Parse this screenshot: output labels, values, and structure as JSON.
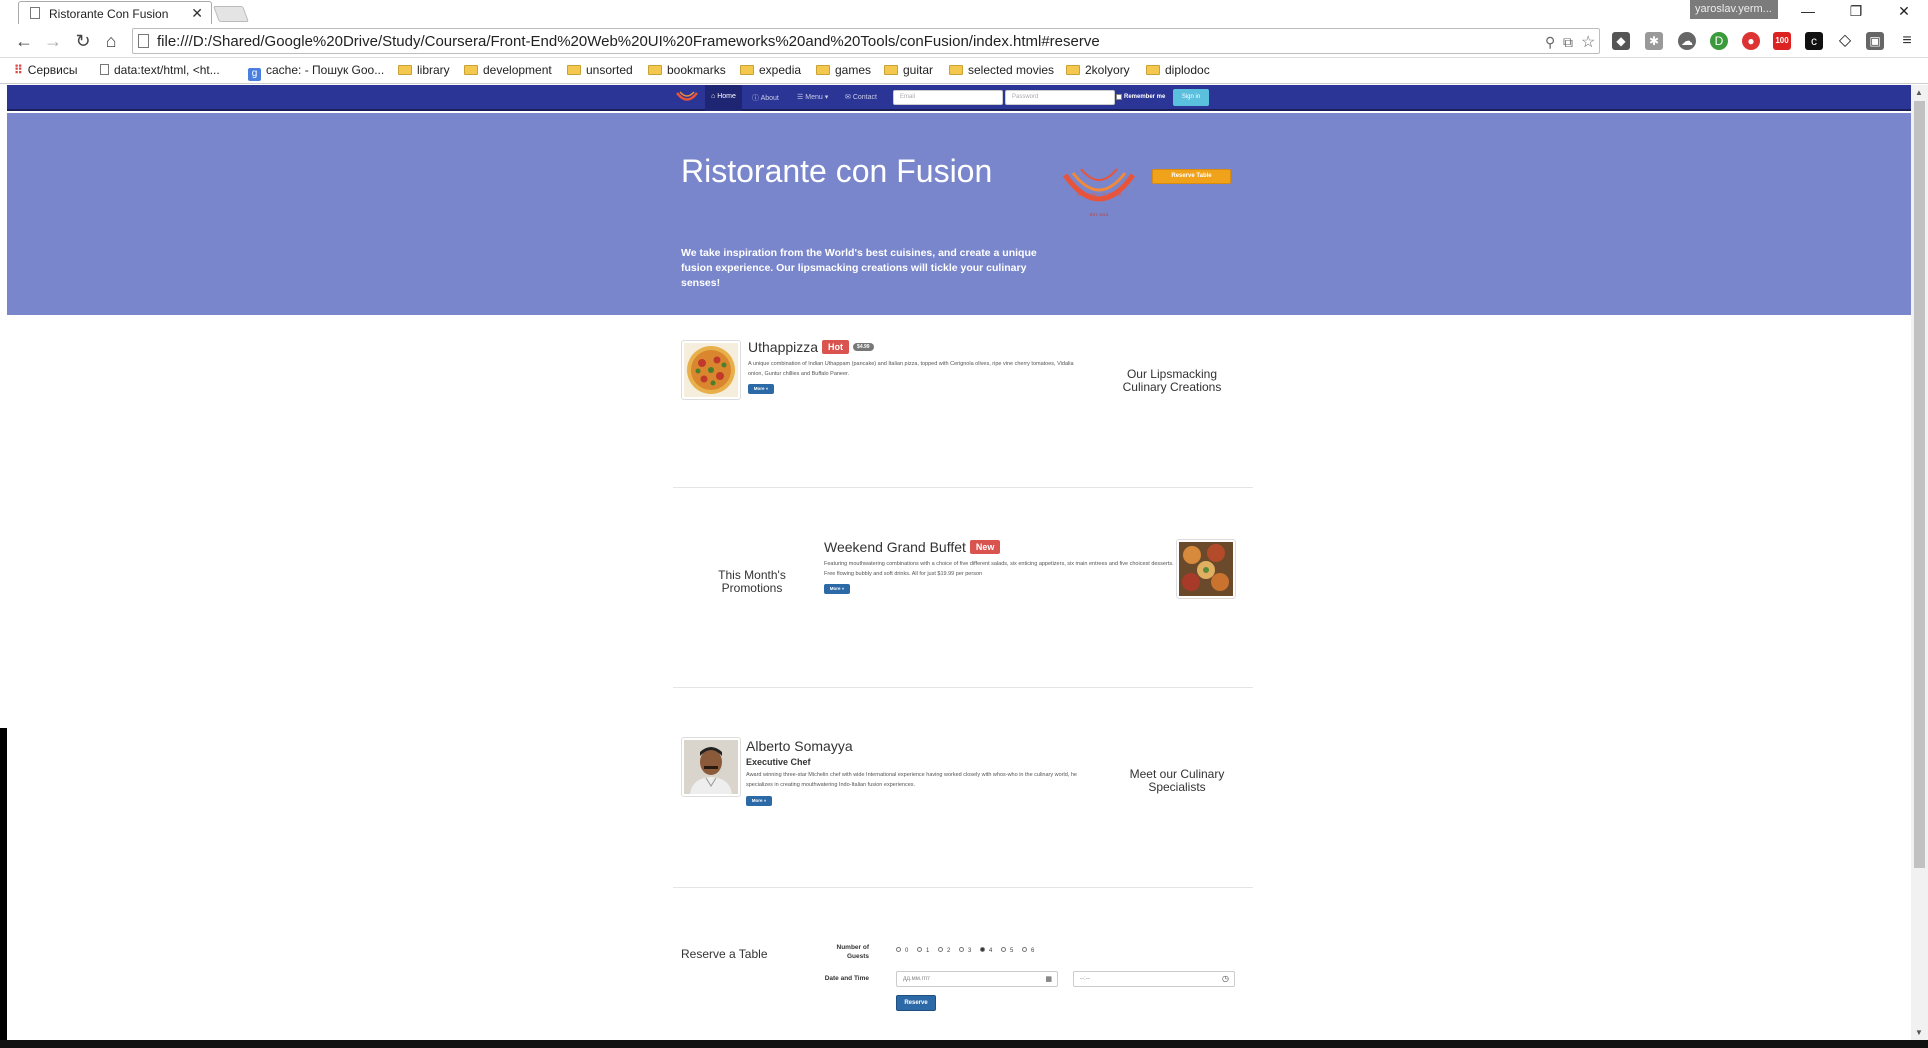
{
  "browser": {
    "tab_title": "Ristorante Con Fusion",
    "user": "yaroslav.yerm...",
    "url": "file:///D:/Shared/Google%20Drive/Study/Coursera/Front-End%20Web%20UI%20Frameworks%20and%20Tools/conFusion/index.html#reserve",
    "bookmarks": [
      "Сервисы",
      "data:text/html, <ht...",
      "cache: - Пошук Goo...",
      "library",
      "development",
      "unsorted",
      "bookmarks",
      "expedia",
      "games",
      "guitar",
      "selected movies",
      "2kolyory",
      "diplodoc"
    ],
    "ext_badge": "100"
  },
  "nav": {
    "items": [
      "Home",
      "About",
      "Menu",
      "Contact"
    ],
    "email_placeholder": "Email",
    "password_placeholder": "Password",
    "remember": "Remember me",
    "signin": "Sign in"
  },
  "jumbotron": {
    "title": "Ristorante con Fusion",
    "text": "We take inspiration from the World's best cuisines, and create a unique fusion experience. Our lipsmacking creations will tickle your culinary senses!",
    "reserve_button": "Reserve Table",
    "logo_text": "Ristorante con Fusion",
    "logo_est": "EST. 2013"
  },
  "dish": {
    "name": "Uthappizza",
    "badge": "Hot",
    "price": "$4.99",
    "description": "A unique combination of Indian Uthappam (pancake) and Italian pizza, topped with Cerignola olives, ripe vine cherry tomatoes, Vidalia onion, Guntur chillies and Buffalo Paneer.",
    "more": "More »",
    "side_heading": "Our Lipsmacking Culinary Creations"
  },
  "promotion": {
    "name": "Weekend Grand Buffet",
    "badge": "New",
    "description": "Featuring mouthwatering combinations with a choice of five different salads, six enticing appetizers, six main entrees and five choicest desserts. Free flowing bubbly and soft drinks. All for just $19.99 per person",
    "more": "More »",
    "side_heading": "This Month's Promotions"
  },
  "leader": {
    "name": "Alberto Somayya",
    "designation": "Executive Chef",
    "description": "Award winning three-star Michelin chef with wide International experience having worked closely with whos-who in the culinary world, he specializes in creating mouthwatering Indo-Italian fusion experiences.",
    "more": "More »",
    "side_heading": "Meet our Culinary Specialists"
  },
  "reserve": {
    "heading": "Reserve a Table",
    "guests_label": "Number of Guests",
    "guest_options": [
      "0",
      "1",
      "2",
      "3",
      "4",
      "5",
      "6"
    ],
    "selected_guests": "4",
    "datetime_label": "Date and Time",
    "date_placeholder": "дд.мм.гггг",
    "time_placeholder": "--:--",
    "submit": "Reserve"
  },
  "colors": {
    "navbar": "#2b3596",
    "jumbotron": "#7986cb",
    "reserve_button": "#f0a21b",
    "badge_red": "#d9534f",
    "primary": "#2b6aa6"
  }
}
